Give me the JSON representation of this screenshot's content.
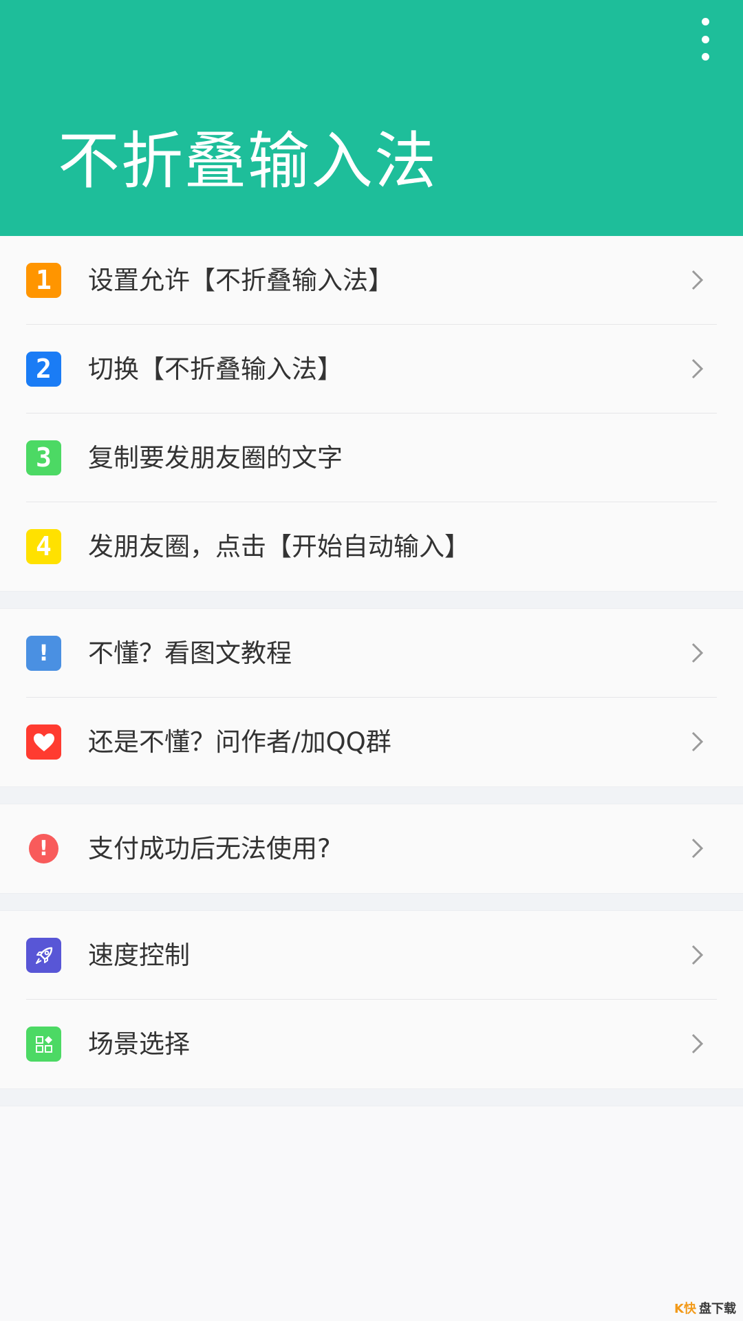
{
  "header": {
    "title": "不折叠输入法",
    "menu_icon": "more-vertical-icon",
    "background": "#1ebe9a"
  },
  "groups": [
    {
      "items": [
        {
          "badge": "1",
          "label": "设置允许【不折叠输入法】",
          "color": "#ff9500",
          "arrow": true
        },
        {
          "badge": "2",
          "label": "切换【不折叠输入法】",
          "color": "#1a7cf5",
          "arrow": true
        },
        {
          "badge": "3",
          "label": "复制要发朋友圈的文字",
          "color": "#4cd964",
          "arrow": false
        },
        {
          "badge": "4",
          "label": "发朋友圈，点击【开始自动输入】",
          "color": "#ffe100",
          "arrow": false
        }
      ]
    },
    {
      "items": [
        {
          "badge": "!",
          "label": "不懂？看图文教程",
          "color": "#4a90e2",
          "arrow": true
        },
        {
          "badge": "heart",
          "label": "还是不懂？问作者/加QQ群",
          "color": "#ff3b30",
          "arrow": true
        }
      ]
    },
    {
      "items": [
        {
          "badge": "!",
          "label": "支付成功后无法使用?",
          "color": "#f85b5b",
          "arrow": true
        }
      ]
    },
    {
      "items": [
        {
          "badge": "rocket",
          "label": "速度控制",
          "color": "#5856d6",
          "arrow": true
        },
        {
          "badge": "grid",
          "label": "场景选择",
          "color": "#4cd964",
          "arrow": true
        }
      ]
    }
  ],
  "watermark": {
    "mark": "K快",
    "text": "盘下载"
  }
}
